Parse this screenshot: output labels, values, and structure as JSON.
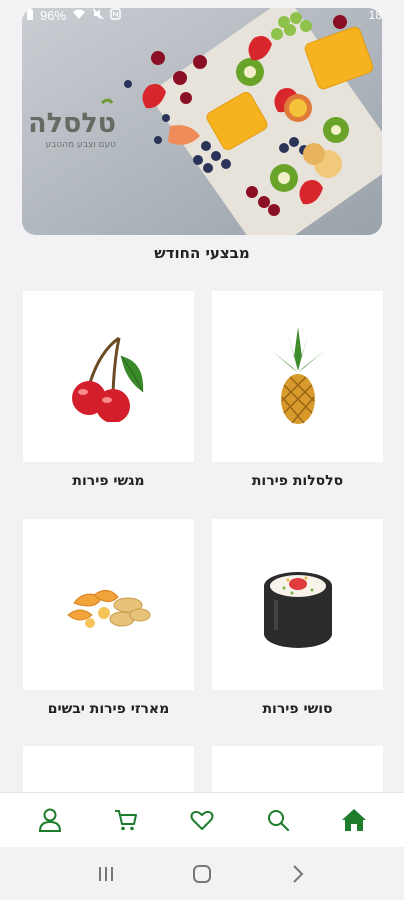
{
  "status_bar": {
    "battery": "96%",
    "time": "18"
  },
  "banner": {
    "brand_name": "טלסלה",
    "tagline": "טעם וצבע מהטבע"
  },
  "promo_title": "מבצעי החודש",
  "categories": [
    {
      "label": "סלסלות פירות",
      "icon": "pineapple-icon"
    },
    {
      "label": "מגשי פירות",
      "icon": "cherries-icon"
    },
    {
      "label": "סושי פירות",
      "icon": "sushi-roll-icon"
    },
    {
      "label": "מארזי פירות יבשים",
      "icon": "dried-fruit-icon"
    },
    {
      "label": "",
      "icon": ""
    },
    {
      "label": "",
      "icon": ""
    }
  ],
  "bottom_nav": [
    {
      "name": "home",
      "icon": "home-icon",
      "active": true
    },
    {
      "name": "search",
      "icon": "search-icon",
      "active": false
    },
    {
      "name": "favorites",
      "icon": "heart-icon",
      "active": false
    },
    {
      "name": "cart",
      "icon": "cart-icon",
      "active": false
    },
    {
      "name": "profile",
      "icon": "user-icon",
      "active": false
    }
  ],
  "colors": {
    "brand_green": "#1e7d2c",
    "page_bg": "#f2f1f3",
    "card_bg": "#ffffff"
  }
}
